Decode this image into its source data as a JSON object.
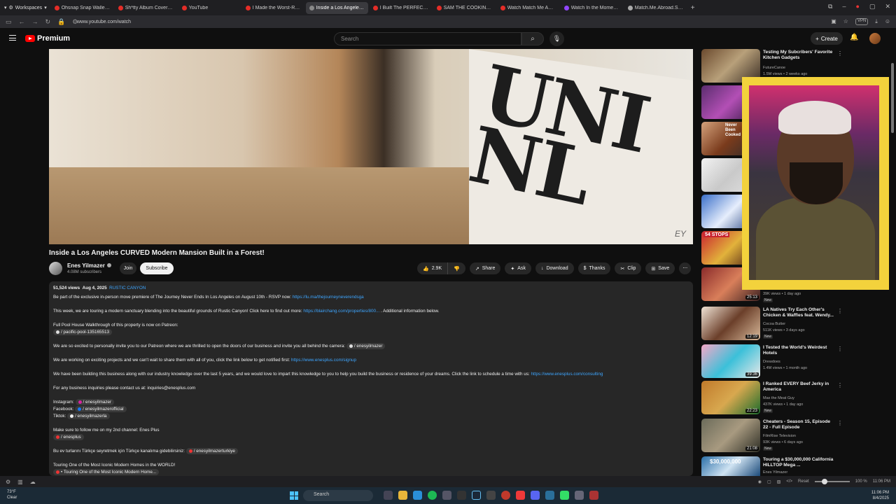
{
  "browser": {
    "workspaces_label": "Workspaces",
    "tabs": [
      {
        "title": "Ohsnap Snap Wallet! BEST",
        "active": false,
        "icon": "youtube"
      },
      {
        "title": "Sh*tty Album Covers - You",
        "active": false,
        "icon": "youtube"
      },
      {
        "title": "YouTube",
        "active": false,
        "icon": "youtube"
      },
      {
        "title": "I Made the Worst-Rated Ti",
        "active": false,
        "icon": "youtube"
      },
      {
        "title": "Inside a Los Angeles CURV",
        "active": true,
        "icon": "audio"
      },
      {
        "title": "I Built The PERFECT Chocol",
        "active": false,
        "icon": "youtube"
      },
      {
        "title": "SAM THE COOKING GUY -",
        "active": false,
        "icon": "youtube"
      },
      {
        "title": "Watch Match Me Abroad S",
        "active": false,
        "icon": "youtube"
      },
      {
        "title": "Watch In the Moment (201",
        "active": false,
        "icon": "twitch"
      },
      {
        "title": "Match.Me.Abroad.S01E13",
        "active": false,
        "icon": "generic"
      }
    ],
    "url": "www.youtube.com/watch",
    "vpn_label": "VPN"
  },
  "youtube": {
    "brand": "Premium",
    "search_placeholder": "Search",
    "create_label": "Create"
  },
  "video": {
    "title": "Inside a Los Angeles CURVED Modern Mansion Built in a Forest!",
    "scene_letters": "UNI\nNL",
    "watermark": "EY",
    "channel": {
      "name": "Enes Yilmazer",
      "subscribers": "4.08M subscribers"
    },
    "join_label": "Join",
    "subscribe_label": "Subscribe",
    "actions": {
      "likes": "2.9K",
      "share": "Share",
      "ask": "Ask",
      "download": "Download",
      "thanks": "Thanks",
      "clip": "Clip",
      "save": "Save"
    }
  },
  "description": {
    "views": "51,524 views",
    "date": "Aug 4, 2025",
    "tag": "RUSTIC CANYON",
    "lines": {
      "l1a": "Be part of the exclusive in-person move premiere of The Journey Never Ends In Los Angeles on August 10th - RSVP now: ",
      "l1link": "https://lu.ma/thejourneyneverendsga",
      "l2a": "This week, we are touring a modern sanctuary blending into the beautiful grounds of Rustic Canyon! Click here to find out more: ",
      "l2link": "https://blairchang.com/properties/800...",
      "l2b": " . Additional information below.",
      "l3": "Full Pool House Walkthrough of this property is now on Patreon:",
      "l3chip": "/ pacific-pool-135165513",
      "l4a": "We are so excited to personally invite you to our Patreon where we are thrilled to open the doors of our business and invite you all behind the camera: ",
      "l4chip": "/ enesyilmazer",
      "l5a": "We are working on exciting projects and we can't wait to share them with all of you, click the link below to get notified first: ",
      "l5link": "https://www.enesplus.com/signup",
      "l6a": "We have been building this business along with our industry knowledge over the last 5 years, and we would love to impart this knowledge to you to help you build the business or residence of your dreams. Click the link to schedule a time with us: ",
      "l6link": "https://www.enesplus.com/consulting",
      "l7": "For any business inquiries please contact us at: inquiries@enesplus.com",
      "l8a": "Instagram: ",
      "l8chip": "/ enesyilmazer",
      "l9a": "Facebook: ",
      "l9chip": "/ enesyilmazerofficial",
      "l10a": "Tiktok: ",
      "l10chip": "/ enesyilmazerla",
      "l11": "Make sure to follow me on my 2nd channel: Enes Plus",
      "l11chip": "/ enesplus",
      "l12a": "Bu ev turlarını Türkçe seyretmek için Türkçe kanalıma gidebilirsiniz: ",
      "l12chip": "/ enesyilmazerturkiye",
      "l13": "Touring One of the Most Iconic Modern Homes in the WORLD!",
      "l13chip": "• Touring One of the Most Iconic Modern Home..."
    }
  },
  "recommendations": [
    {
      "title": "Testing My Subcribers' Favorite Kitchen Gadgets",
      "channel": "FutureCanoe",
      "meta": "1.5M views • 2 weeks ago",
      "duration": "",
      "badge": ""
    },
    {
      "title": "",
      "channel": "",
      "meta": "",
      "duration": "",
      "badge": ""
    },
    {
      "title": "",
      "channel": "",
      "meta": "",
      "duration": "",
      "badge": ""
    },
    {
      "title": "",
      "channel": "",
      "meta": "",
      "duration": "",
      "badge": ""
    },
    {
      "title": "",
      "channel": "",
      "meta": "",
      "duration": "",
      "badge": ""
    },
    {
      "title": "",
      "channel": "",
      "meta": "",
      "duration": "",
      "badge": ""
    },
    {
      "title": "",
      "channel": "",
      "meta": "39K views • 1 day ago",
      "duration": "25:13",
      "badge": "New"
    },
    {
      "title": "LA Natives Try Each Other's Chicken & Waffles feat. Wendy...",
      "channel": "Cocoa Butter",
      "meta": "511K views • 3 days ago",
      "duration": "12:19",
      "badge": "New"
    },
    {
      "title": "I Tested the World's Weirdest Hotels",
      "channel": "Drewdoes",
      "meta": "1.4M views • 1 month ago",
      "duration": "39:36",
      "badge": ""
    },
    {
      "title": "I Ranked EVERY Beef Jerky in America",
      "channel": "Max the Meat Guy",
      "meta": "437K views • 1 day ago",
      "duration": "22:23",
      "badge": "New"
    },
    {
      "title": "Cheaters - Season 15, Episode 22 - Full Episode",
      "channel": "FilmRise Television",
      "meta": "93K views • 6 days ago",
      "duration": "21:08",
      "badge": "New"
    },
    {
      "title": "Touring a $30,000,000 California HILLTOP Mega ...",
      "channel": "Enes Yilmazer",
      "meta": "",
      "duration": "",
      "badge": ""
    }
  ],
  "thumb_texts": {
    "t3": "Never Been Cooked",
    "t6": "54 STOPS",
    "t12": "$30,000,000"
  },
  "statusbar": {
    "reset": "Reset",
    "zoom": "100 %",
    "time": "11:06 PM"
  },
  "taskbar": {
    "weather_temp": "73°F",
    "weather_desc": "Clear",
    "search": "Search",
    "time": "11:06 PM",
    "date": "8/4/2025"
  },
  "colors": {
    "accent_red": "#ff0000",
    "link": "#3ea6ff",
    "pip_frame": "#f3d23c"
  }
}
